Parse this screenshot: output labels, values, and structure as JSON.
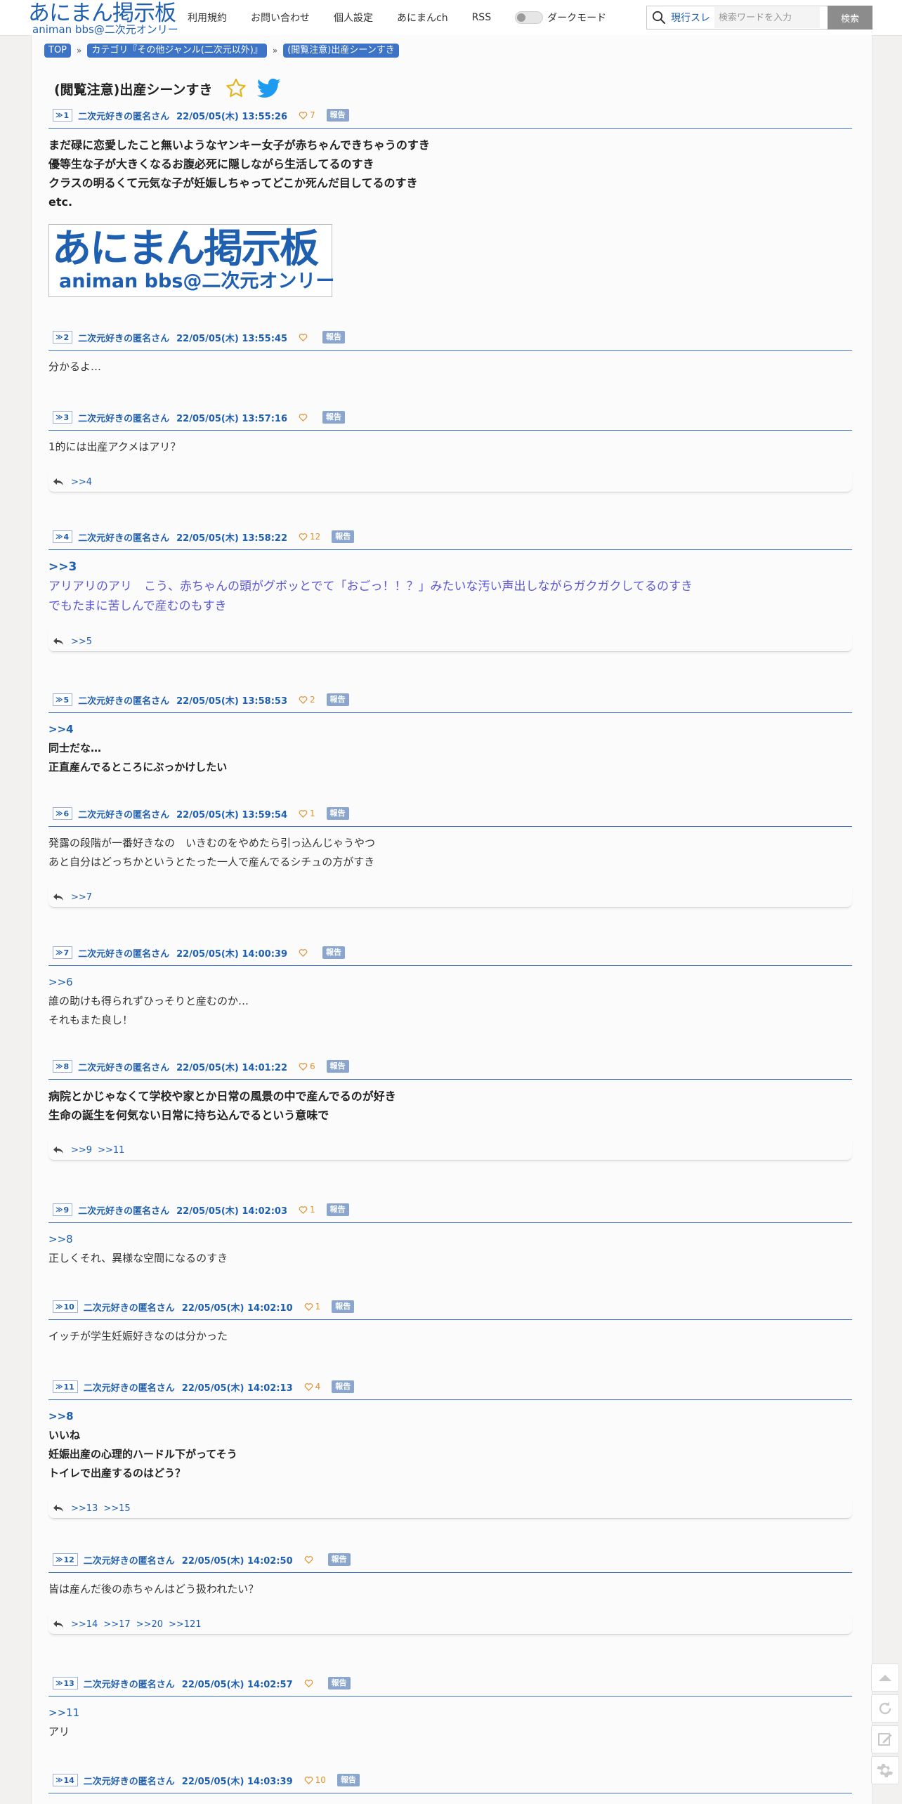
{
  "header": {
    "logo_main": "あにまん掲示板",
    "logo_sub": "animan bbs@二次元オンリー",
    "nav": [
      {
        "label": "利用規約"
      },
      {
        "label": "お問い合わせ"
      },
      {
        "label": "個人設定"
      },
      {
        "label": "あにまんch"
      },
      {
        "label": "RSS"
      }
    ],
    "dark_mode_label": "ダークモード",
    "search": {
      "scope": "現行スレ",
      "placeholder": "検索ワードを入力",
      "button": "検索"
    }
  },
  "breadcrumb": [
    {
      "label": "TOP"
    },
    {
      "label": "カテゴリ『その他ジャンル(二次元以外)』"
    },
    {
      "label": "(閲覧注意)出産シーンすき"
    }
  ],
  "breadcrumb_sep": "»",
  "thread": {
    "title": "(閲覧注意)出産シーンすき"
  },
  "icons": {
    "star": "star-icon",
    "twitter": "twitter-icon",
    "heart": "heart-icon",
    "reply": "reply-arrow-icon",
    "search": "search-icon",
    "accent": "#1f5fb0",
    "like_color": "#e0922f",
    "report_bg": "#8aa6cf"
  },
  "report_label": "報告",
  "image": {
    "main": "あにまん掲示板",
    "sub": "animan bbs@二次元オンリー"
  },
  "posts": [
    {
      "num": "1",
      "name": "二次元好きの匿名さん",
      "date": "22/05/05(木) 13:55:26",
      "likes": "7",
      "lines": [
        "まだ碌に恋愛したこと無いようなヤンキー女子が赤ちゃんできちゃうのすき",
        "優等生な子が大きくなるお腹必死に隠しながら生活してるのすき",
        "クラスの明るくて元気な子が妊娠しちゃってどこか死んだ目してるのすき",
        "etc."
      ]
    },
    {
      "num": "2",
      "name": "二次元好きの匿名さん",
      "date": "22/05/05(木) 13:55:45",
      "likes": "",
      "lines": [
        "分かるよ…"
      ]
    },
    {
      "num": "3",
      "name": "二次元好きの匿名さん",
      "date": "22/05/05(木) 13:57:16",
      "likes": "",
      "lines": [
        "1的には出産アクメはアリ？"
      ],
      "replies": [
        ">>4"
      ]
    },
    {
      "num": "4",
      "name": "二次元好きの匿名さん",
      "date": "22/05/05(木) 13:58:22",
      "likes": "12",
      "anchor": ">>3",
      "lines": [
        "アリアリのアリ　こう、赤ちゃんの頭がグボッとでて「おごっ！！？」みたいな汚い声出しながらガクガクしてるのすき",
        "でもたまに苦しんで産むのもすき"
      ],
      "replies": [
        ">>5"
      ]
    },
    {
      "num": "5",
      "name": "二次元好きの匿名さん",
      "date": "22/05/05(木) 13:58:53",
      "likes": "2",
      "anchor": ">>4",
      "lines": [
        "同士だな…",
        "正直産んでるところにぶっかけしたい"
      ]
    },
    {
      "num": "6",
      "name": "二次元好きの匿名さん",
      "date": "22/05/05(木) 13:59:54",
      "likes": "1",
      "lines": [
        "発露の段階が一番好きなの　いきむのをやめたら引っ込んじゃうやつ",
        "あと自分はどっちかというとたった一人で産んでるシチュの方がすき"
      ],
      "replies": [
        ">>7"
      ]
    },
    {
      "num": "7",
      "name": "二次元好きの匿名さん",
      "date": "22/05/05(木) 14:00:39",
      "likes": "",
      "anchor": ">>6",
      "lines": [
        "誰の助けも得られずひっそりと産むのか…",
        "それもまた良し！"
      ]
    },
    {
      "num": "8",
      "name": "二次元好きの匿名さん",
      "date": "22/05/05(木) 14:01:22",
      "likes": "6",
      "lines": [
        "病院とかじゃなくて学校や家とか日常の風景の中で産んでるのが好き",
        "生命の誕生を何気ない日常に持ち込んでるという意味で"
      ],
      "replies": [
        ">>9",
        ">>11"
      ]
    },
    {
      "num": "9",
      "name": "二次元好きの匿名さん",
      "date": "22/05/05(木) 14:02:03",
      "likes": "1",
      "anchor": ">>8",
      "lines": [
        "正しくそれ、異様な空間になるのすき"
      ]
    },
    {
      "num": "10",
      "name": "二次元好きの匿名さん",
      "date": "22/05/05(木) 14:02:10",
      "likes": "1",
      "lines": [
        "イッチが学生妊娠好きなのは分かった"
      ]
    },
    {
      "num": "11",
      "name": "二次元好きの匿名さん",
      "date": "22/05/05(木) 14:02:13",
      "likes": "4",
      "anchor": ">>8",
      "lines": [
        "いいね",
        "妊娠出産の心理的ハードル下がってそう",
        "トイレで出産するのはどう？"
      ],
      "replies": [
        ">>13",
        ">>15"
      ]
    },
    {
      "num": "12",
      "name": "二次元好きの匿名さん",
      "date": "22/05/05(木) 14:02:50",
      "likes": "",
      "lines": [
        "皆は産んだ後の赤ちゃんはどう扱われたい？"
      ],
      "replies": [
        ">>14",
        ">>17",
        ">>20",
        ">>121"
      ]
    },
    {
      "num": "13",
      "name": "二次元好きの匿名さん",
      "date": "22/05/05(木) 14:02:57",
      "likes": "",
      "anchor": ">>11",
      "lines": [
        "アリ"
      ]
    },
    {
      "num": "14",
      "name": "二次元好きの匿名さん",
      "date": "22/05/05(木) 14:03:39",
      "likes": "10",
      "lines": []
    }
  ],
  "side_tools": [
    {
      "icon": "scroll-top-icon"
    },
    {
      "icon": "reload-icon"
    },
    {
      "icon": "edit-icon"
    },
    {
      "icon": "settings-gear-icon"
    }
  ]
}
